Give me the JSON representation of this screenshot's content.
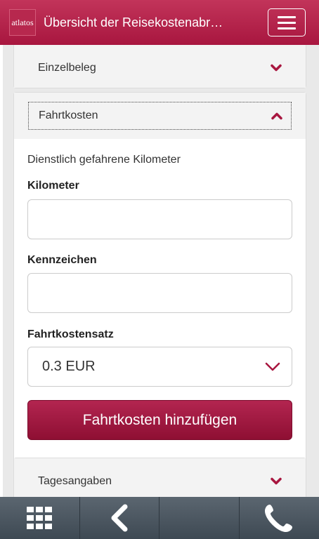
{
  "header": {
    "logo_text": "atlatos",
    "title": "Übersicht der Reisekostenabre…"
  },
  "sections": {
    "einzelbeleg": {
      "label": "Einzelbeleg",
      "expanded": false
    },
    "fahrtkosten": {
      "label": "Fahrtkosten",
      "expanded": true,
      "subtitle": "Dienstlich gefahrene Kilometer",
      "kilometer_label": "Kilometer",
      "kilometer_value": "",
      "kennzeichen_label": "Kennzeichen",
      "kennzeichen_value": "",
      "satz_label": "Fahrtkostensatz",
      "satz_value": "0.3 EUR",
      "add_button": "Fahrtkosten hinzufügen"
    },
    "tagesangaben": {
      "label": "Tagesangaben",
      "expanded": false
    }
  },
  "footer": {
    "buttons": [
      "grid-icon",
      "back-icon",
      "",
      "phone-icon"
    ]
  },
  "colors": {
    "accent": "#a8163f",
    "footer": "#4a555f"
  }
}
